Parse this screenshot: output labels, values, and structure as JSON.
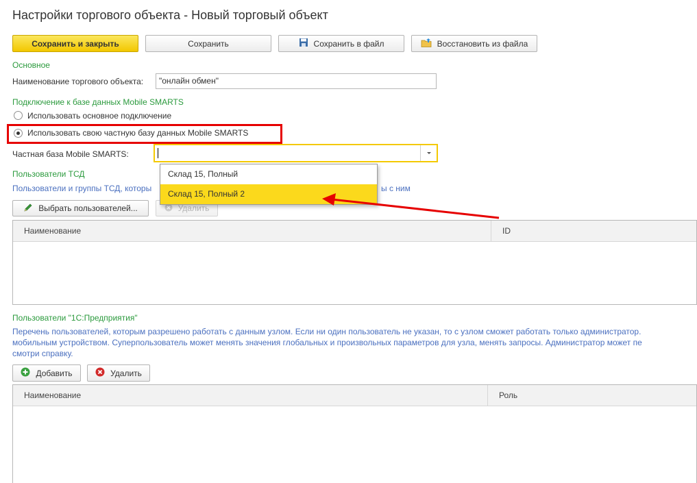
{
  "window": {
    "title": "Настройки торгового объекта - Новый торговый объект"
  },
  "toolbar": {
    "save_close": "Сохранить и закрыть",
    "save": "Сохранить",
    "save_file": "Сохранить в файл",
    "restore_file": "Восстановить из файла"
  },
  "main": {
    "section": "Основное",
    "name_label": "Наименование торгового объекта:",
    "name_value": "\"онлайн обмен\""
  },
  "connection": {
    "section": "Подключение к базе данных Mobile SMARTS",
    "option_main": "Использовать основное подключение",
    "option_private": "Использовать свою частную базу данных Mobile SMARTS",
    "private_label": "Частная база Mobile SMARTS:",
    "private_value": "",
    "dropdown": [
      "Склад 15, Полный",
      "Склад 15, Полный 2"
    ]
  },
  "tsd_users": {
    "section": "Пользователи ТСД",
    "hint_left": "Пользователи и группы ТСД, которы",
    "hint_right": "ы с ним",
    "select_button": "Выбрать пользователей...",
    "delete_button": "Удалить",
    "columns": [
      "Наименование",
      "ID"
    ]
  },
  "ent_users": {
    "section": "Пользователи \"1С:Предприятия\"",
    "hint_lines": [
      "Перечень пользователей, которым разрешено работать с данным узлом.  Если ни один пользователь не указан, то с узлом сможет работать только администратор.",
      "мобильным устройством.  Суперпользователь может менять значения глобальных и произвольных параметров для узла, менять запросы. Администратор может пе",
      "смотри справку."
    ],
    "add_button": "Добавить",
    "delete_button": "Удалить",
    "columns": [
      "Наименование",
      "Роль"
    ]
  },
  "colors": {
    "accent_yellow": "#f2c700",
    "section_green": "#2b9a3d",
    "hint_blue": "#4a6fbf",
    "highlight_red": "#e60000"
  }
}
